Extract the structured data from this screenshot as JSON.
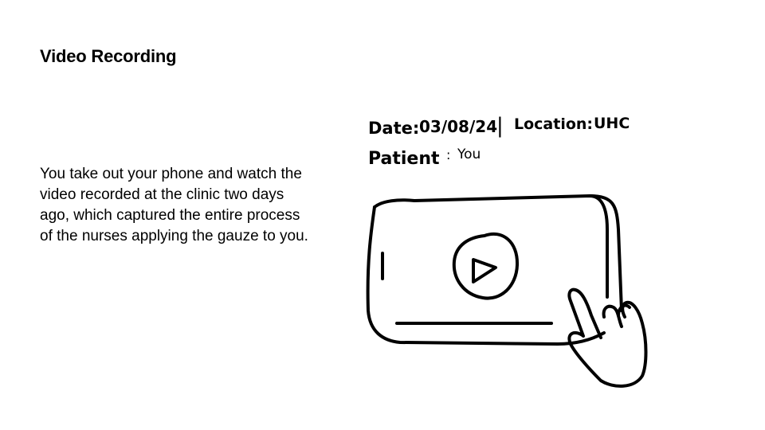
{
  "slide": {
    "title": "Video Recording",
    "body": "You take out your phone and watch the video recorded at the clinic two days ago, which captured the entire process of the nurses applying the gauze to you."
  },
  "sketch": {
    "date_label": "Date:",
    "date_value": "03/08/24",
    "separator": "|",
    "location_label": "Location:",
    "location_value": "UHC",
    "patient_label": "Patient",
    "patient_colon": ":",
    "patient_value": "You",
    "icons": [
      "phone-sketch",
      "play-icon",
      "tapping-hand-icon"
    ],
    "ink_color": "#000000"
  }
}
